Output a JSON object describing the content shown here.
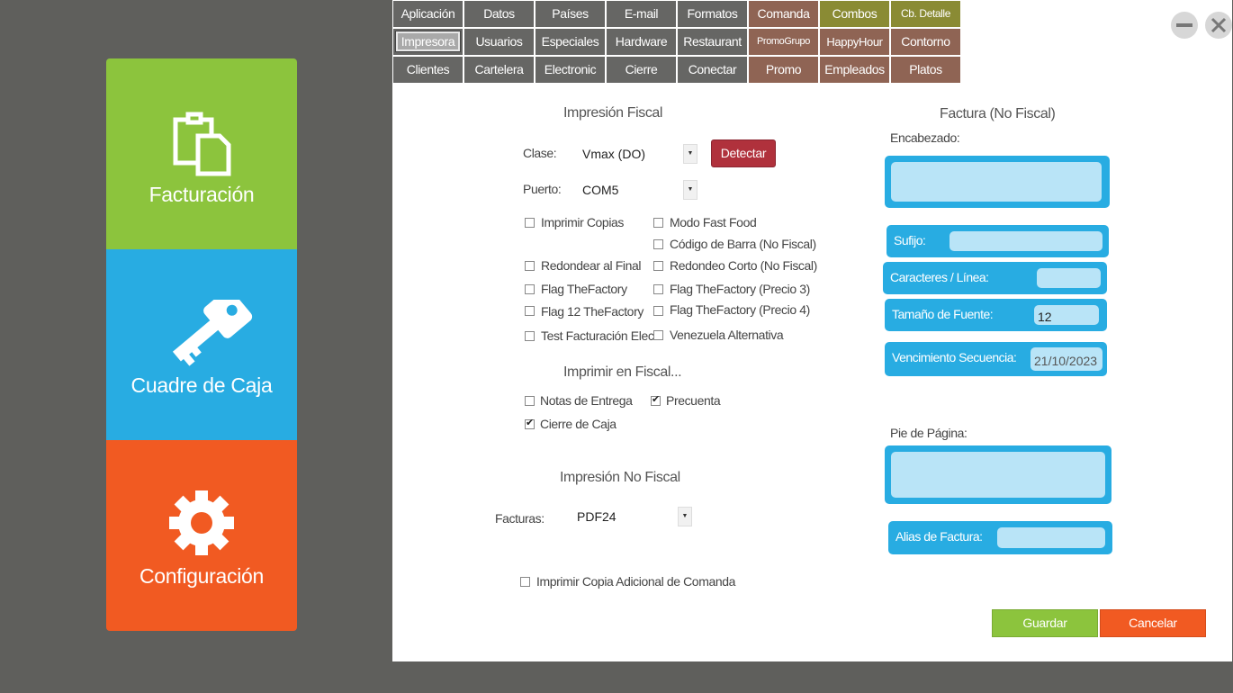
{
  "sidebar": {
    "facturacion": "Facturación",
    "cuadre": "Cuadre de Caja",
    "configuracion": "Configuración"
  },
  "tabs": {
    "row1": [
      "Aplicación",
      "Datos",
      "Países",
      "E-mail",
      "Formatos",
      "Comanda",
      "Combos",
      "Cb. Detalle"
    ],
    "row2": [
      "Impresora",
      "Usuarios",
      "Especiales",
      "Hardware",
      "Restaurant",
      "PromoGrupo",
      "HappyHour",
      "Contorno"
    ],
    "row3": [
      "Clientes",
      "Cartelera",
      "Electronic",
      "Cierre",
      "Conectar",
      "Promo",
      "Empleados",
      "Platos"
    ]
  },
  "fiscal": {
    "title": "Impresión Fiscal",
    "clase_label": "Clase:",
    "clase_value": "Vmax (DO)",
    "detectar": "Detectar",
    "puerto_label": "Puerto:",
    "puerto_value": "COM5",
    "checks": {
      "imprimir_copias": "Imprimir Copias",
      "modo_fast_food": "Modo Fast Food",
      "codigo_barra": "Código de Barra (No Fiscal)",
      "redondear_final": "Redondear al Final",
      "redondeo_corto": "Redondeo Corto (No Fiscal)",
      "flag_thefactory": "Flag TheFactory",
      "flag_thefactory_p3": "Flag TheFactory (Precio 3)",
      "flag_12_thefactory": "Flag 12 TheFactory",
      "flag_thefactory_p4": "Flag TheFactory (Precio 4)",
      "test_facturacion": "Test Facturación Elec.",
      "venezuela_alt": "Venezuela Alternativa"
    }
  },
  "imprimir_fiscal": {
    "title": "Imprimir en Fiscal...",
    "notas_entrega": "Notas de Entrega",
    "precuenta": "Precuenta",
    "cierre_caja": "Cierre de Caja"
  },
  "no_fiscal": {
    "title": "Impresión No Fiscal",
    "facturas_label": "Facturas:",
    "facturas_value": "PDF24",
    "copia_adicional": "Imprimir Copia Adicional de Comanda"
  },
  "factura": {
    "title": "Factura (No Fiscal)",
    "encabezado": "Encabezado:",
    "sufijo": "Sufijo:",
    "caracteres": "Caracteres / Línea:",
    "tamano_fuente": "Tamaño de Fuente:",
    "tamano_value": "12",
    "vencimiento": "Vencimiento Secuencia:",
    "vencimiento_value": "21/10/2023",
    "pie": "Pie de Página:",
    "alias": "Alias de Factura:"
  },
  "actions": {
    "guardar": "Guardar",
    "cancelar": "Cancelar"
  },
  "colors": {
    "green": "#8cc43d",
    "blue": "#28ace2",
    "orange": "#f15a22",
    "detect_red": "#b0313c"
  }
}
